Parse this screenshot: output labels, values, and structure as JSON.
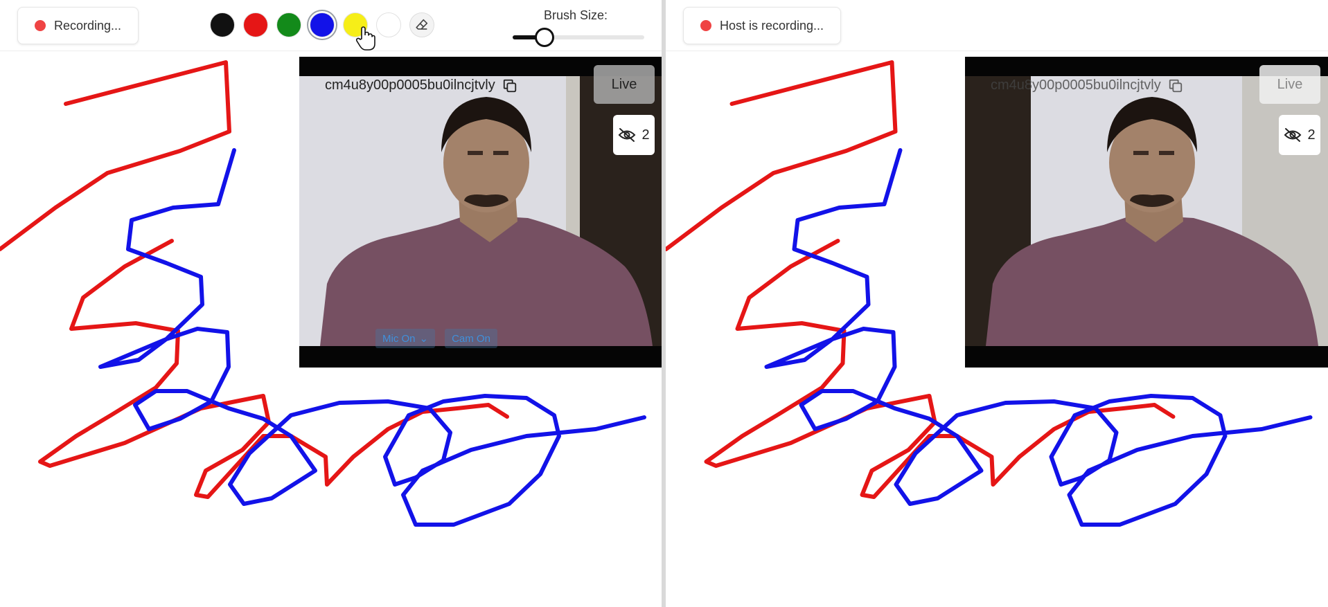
{
  "left": {
    "recording_status": "Recording...",
    "brush_label": "Brush Size:",
    "brush_size_fraction": 0.2,
    "palette": [
      {
        "name": "black",
        "hex": "#111111"
      },
      {
        "name": "red",
        "hex": "#e51616"
      },
      {
        "name": "green",
        "hex": "#138a1a"
      },
      {
        "name": "blue",
        "hex": "#1212e8",
        "selected": true
      },
      {
        "name": "yellow",
        "hex": "#f6ee18"
      },
      {
        "name": "white",
        "hex": "#ffffff"
      }
    ],
    "eraser_icon": "eraser-icon",
    "video": {
      "room_code": "cm4u8y00p0005bu0ilncjtvly",
      "copy_icon": "copy-icon",
      "live_label": "Live",
      "viewer_icon": "eye-off-icon",
      "viewer_count": "2",
      "mic_label": "Mic On",
      "cam_label": "Cam On"
    }
  },
  "right": {
    "recording_status": "Host is recording...",
    "video": {
      "room_code": "cm4u8y00p0005bu0ilncjtvly",
      "copy_icon": "copy-icon",
      "live_label": "Live",
      "viewer_icon": "eye-off-icon",
      "viewer_count": "2"
    }
  },
  "stroke_colors": {
    "red": "#e51616",
    "blue": "#1212e8"
  }
}
